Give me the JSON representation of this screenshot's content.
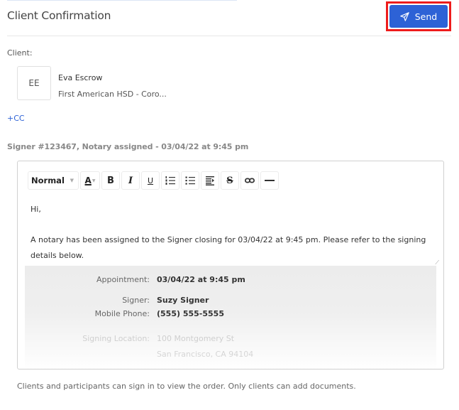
{
  "header": {
    "title": "Client Confirmation",
    "send_label": "Send",
    "send_icon": "paper-plane-icon",
    "accent_color": "#2d62d6",
    "highlight_color": "#ee1c1c"
  },
  "client": {
    "label": "Client:",
    "initials": "EE",
    "name": "Eva Escrow",
    "company": "First American HSD - Coro...",
    "cc_label": "+CC"
  },
  "signer_heading": "Signer #123467, Notary assigned - 03/04/22 at 9:45 pm",
  "editor": {
    "toolbar": {
      "format_select": "Normal",
      "color_letter": "A",
      "bold": "B",
      "italic": "I",
      "underline": "U",
      "strikethrough": "S",
      "icons": [
        "ordered-list-icon",
        "bullet-list-icon",
        "indent-icon",
        "link-icon",
        "horizontal-rule-icon"
      ]
    },
    "greeting": "Hi,",
    "body": "A notary has been assigned to the Signer closing for 03/04/22 at 9:45 pm. Please refer to the signing details below.",
    "details": {
      "appointment_label": "Appointment:",
      "appointment_value": "03/04/22 at 9:45 pm",
      "signer_label": "Signer:",
      "signer_value": "Suzy Signer",
      "phone_label": "Mobile Phone:",
      "phone_value": "(555) 555-5555",
      "location_label": "Signing Location:",
      "location_line1": "100 Montgomery St",
      "location_line2": "San Francisco, CA 94104"
    }
  },
  "footer_note": "Clients and participants can sign in to view the order. Only clients can add documents."
}
